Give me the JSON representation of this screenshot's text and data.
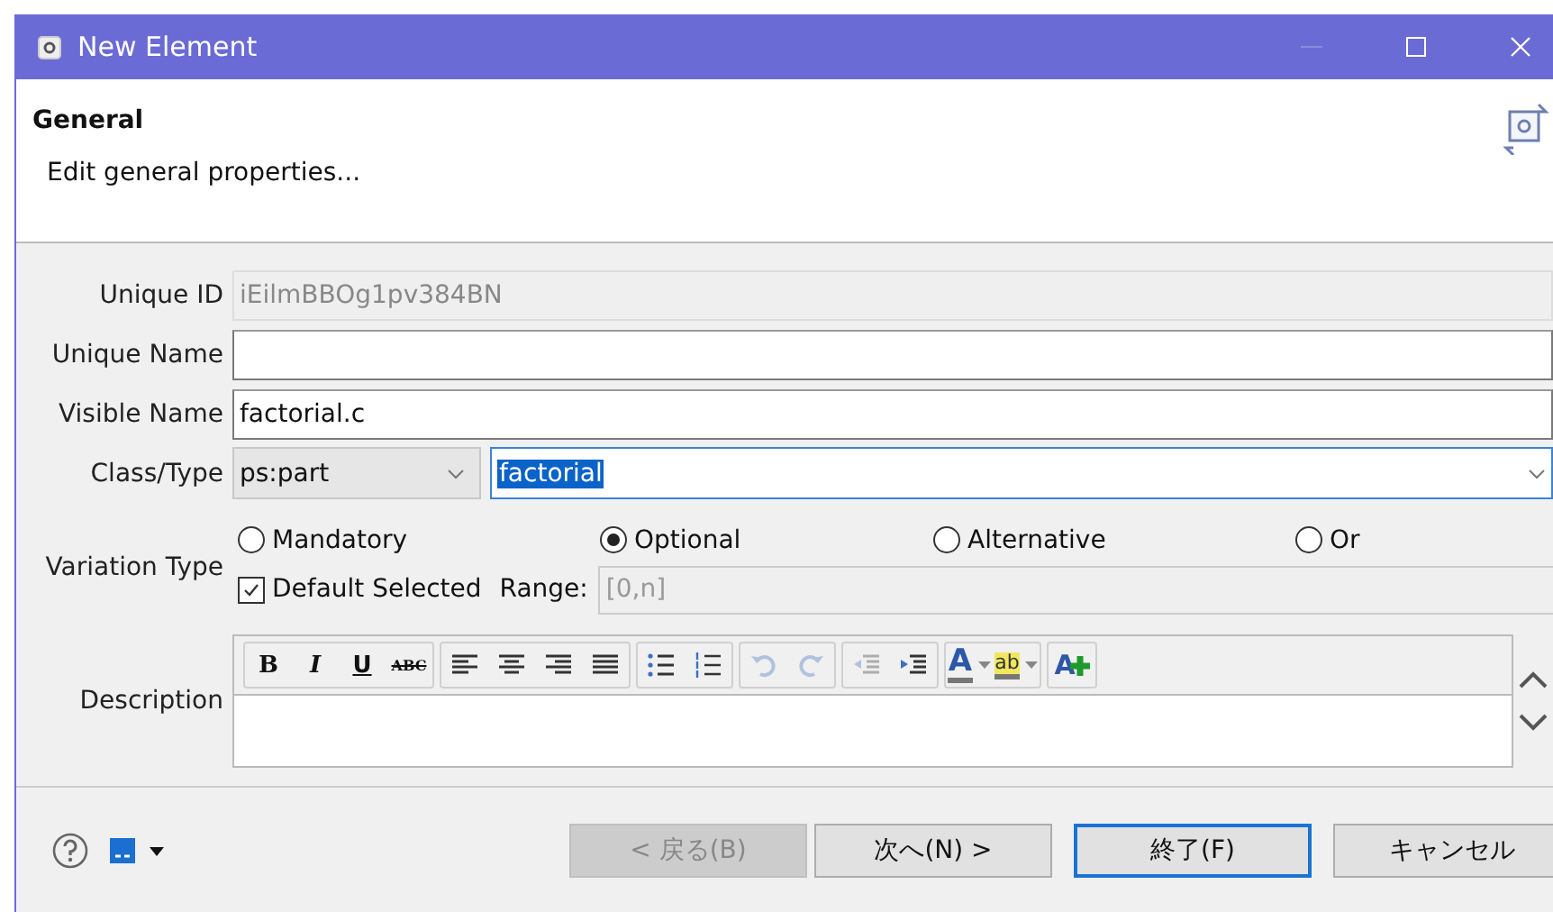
{
  "window": {
    "title": "New Element"
  },
  "header": {
    "title": "General",
    "subtitle": "Edit general properties..."
  },
  "fields": [
    {
      "label": "Unique ID",
      "value": "iEilmBBOg1pv384BN",
      "disabled": true
    },
    {
      "label": "Unique Name",
      "disabled": false
    },
    {
      "label": "Visible Name",
      "value": "factorial.c",
      "disabled": false
    }
  ],
  "class_type": {
    "label": "Class/Type",
    "class": "ps:part",
    "type": "factorial"
  },
  "variation": {
    "label": "Variation Type",
    "options": [
      {
        "label": "Mandatory",
        "selected": false
      },
      {
        "label": "Optional",
        "selected": true
      },
      {
        "label": "Alternative",
        "selected": false
      },
      {
        "label": "Or",
        "selected": false
      }
    ],
    "default_selected": {
      "label": "Default Selected",
      "checked": true
    },
    "range_label": "Range:",
    "range_value": "[0,n]"
  },
  "description": {
    "label": "Description",
    "toolbar": [
      {
        "kind": "bold",
        "text": "B",
        "disabled": false
      },
      {
        "kind": "italic",
        "text": "I",
        "disabled": false
      },
      {
        "kind": "underline",
        "text": "U",
        "disabled": false
      },
      {
        "kind": "strike",
        "text": "ABC",
        "disabled": false
      },
      {
        "kind": "left",
        "disabled": false
      },
      {
        "kind": "center",
        "disabled": false
      },
      {
        "kind": "right",
        "disabled": false
      },
      {
        "kind": "justify",
        "disabled": false
      },
      {
        "kind": "bullets",
        "disabled": false
      },
      {
        "kind": "numbers",
        "disabled": false
      },
      {
        "kind": "undo",
        "disabled": true
      },
      {
        "kind": "redo",
        "disabled": true
      },
      {
        "kind": "outdent",
        "disabled": true
      },
      {
        "kind": "indent",
        "disabled": false
      },
      {
        "kind": "color",
        "text": "A",
        "disabled": false
      },
      {
        "kind": "highlight",
        "text": "ab",
        "disabled": false
      },
      {
        "kind": "add",
        "text": "A",
        "disabled": false
      }
    ]
  },
  "buttons": [
    {
      "label": "< 戻る(B)",
      "disabled": true,
      "default": false
    },
    {
      "label": "次へ(N) >",
      "disabled": false,
      "default": false
    },
    {
      "label": "終了(F)",
      "disabled": false,
      "default": true
    },
    {
      "label": "キャンセル",
      "disabled": false,
      "default": false
    }
  ]
}
